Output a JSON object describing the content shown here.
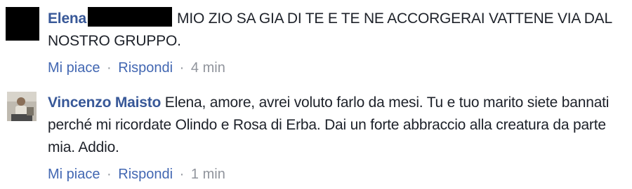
{
  "comments": [
    {
      "author": "Elena",
      "author_redacted": true,
      "text": "MIO ZIO SA GIA DI TE E TE NE ACCORGERAI VATTENE VIA DAL NOSTRO GRUPPO.",
      "like_label": "Mi piace",
      "reply_label": "Rispondi",
      "separator": "·",
      "time": "4 min",
      "avatar": "redacted-black-avatar"
    },
    {
      "author": "Vincenzo Maisto",
      "text": "Elena, amore, avrei voluto farlo da mesi. Tu e tuo marito siete bannati perché mi ricordate Olindo e Rosa di Erba. Dai un forte abbraccio alla creatura da parte mia. Addio.",
      "like_label": "Mi piace",
      "reply_label": "Rispondi",
      "separator": "·",
      "time": "1 min",
      "avatar": "profile-photo-avatar"
    }
  ],
  "colors": {
    "author": "#385898",
    "link": "#4267b2",
    "meta": "#90949c",
    "text": "#1d2129"
  }
}
